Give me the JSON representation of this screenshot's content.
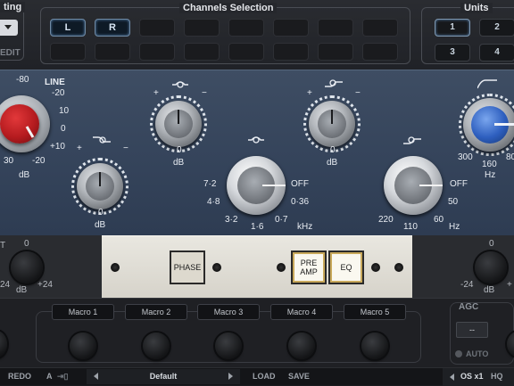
{
  "header": {
    "setting_label": "ting",
    "edit_label": "EDIT",
    "channels_title": "Channels Selection",
    "channel_left": "L",
    "channel_right": "R",
    "units_title": "Units",
    "units": [
      "1",
      "2",
      "3",
      "4"
    ]
  },
  "input": {
    "line_label": "LINE",
    "scale": [
      "-80",
      "-20",
      "10",
      "0",
      "+10",
      "-20",
      "30"
    ],
    "unit": "dB"
  },
  "hf_shelf": {
    "plus": "+",
    "minus": "−",
    "scale_zero": "0",
    "unit": "dB"
  },
  "lf_shelf": {
    "plus": "+",
    "minus": "−",
    "scale_zero": "0",
    "unit": "dB"
  },
  "mid_gain": {
    "plus": "+",
    "minus": "−",
    "scale_zero": "0",
    "unit": "dB"
  },
  "lowmid_gain": {
    "plus": "+",
    "minus": "−",
    "scale_zero": "0",
    "unit": "dB"
  },
  "mid_freq": {
    "values": [
      "7·2",
      "4·8",
      "3·2",
      "1·6",
      "0·7",
      "0·36",
      "OFF"
    ],
    "unit": "kHz"
  },
  "lf_freq": {
    "values": [
      "OFF",
      "50",
      "60",
      "110",
      "220"
    ],
    "unit": "Hz"
  },
  "hpf": {
    "values": [
      "300",
      "160",
      "80"
    ],
    "unit": "Hz"
  },
  "faceplate": {
    "phase_label": "PHASE",
    "preamp_label": "PRE AMP",
    "eq_label": "EQ"
  },
  "trim_left": {
    "label_t": "T",
    "zero": "0",
    "min": "24",
    "max": "+24",
    "unit": "dB"
  },
  "trim_right": {
    "zero": "0",
    "min": "-24",
    "max": "+",
    "unit": "dB"
  },
  "macros": [
    "Macro 1",
    "Macro 2",
    "Macro 3",
    "Macro 4",
    "Macro 5"
  ],
  "agc": {
    "title": "AGC",
    "value": "--",
    "auto_label": "AUTO"
  },
  "bottom": {
    "redo": "REDO",
    "a_label": "A",
    "preset": "Default",
    "load": "LOAD",
    "save": "SAVE",
    "os": "OS x1",
    "hq": "HQ"
  },
  "colors": {
    "panel_blue": "#3a4a60",
    "accent_blue": "#5a86b5",
    "red_knob": "#c41d22",
    "blue_knob": "#2e5fbf"
  }
}
